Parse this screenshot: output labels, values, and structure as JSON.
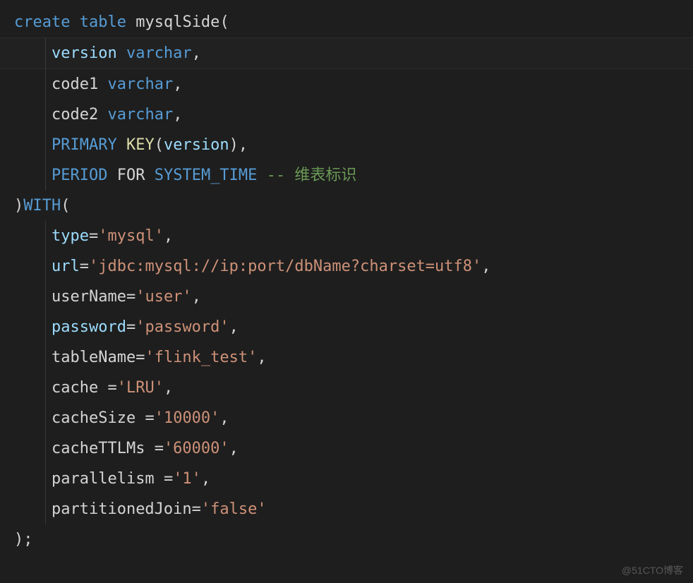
{
  "code": {
    "line1": {
      "kw1": "create",
      "kw2": "table",
      "name": "mysqlSide",
      "paren": "("
    },
    "line2": {
      "col": "version",
      "type": "varchar",
      "comma": ","
    },
    "line3": {
      "col": "code1",
      "type": "varchar",
      "comma": ","
    },
    "line4": {
      "col": "code2",
      "type": "varchar",
      "comma": ","
    },
    "line5": {
      "pk": "PRIMARY",
      "key": "KEY",
      "paren_open": "(",
      "col": "version",
      "paren_close": ")",
      "comma": ","
    },
    "line6": {
      "period": "PERIOD",
      "for": "FOR",
      "systime": "SYSTEM_TIME",
      "comment": "-- 维表标识"
    },
    "line7": {
      "close": ")",
      "with": "WITH",
      "open": "("
    },
    "line8": {
      "prop": "type",
      "eq": "=",
      "val": "'mysql'",
      "comma": ","
    },
    "line9": {
      "prop": "url",
      "eq": "=",
      "val": "'jdbc:mysql://ip:port/dbName?charset=utf8'",
      "comma": ","
    },
    "line10": {
      "prop": "userName",
      "eq": "=",
      "val": "'user'",
      "comma": ","
    },
    "line11": {
      "prop": "password",
      "eq": "=",
      "val": "'password'",
      "comma": ","
    },
    "line12": {
      "prop": "tableName",
      "eq": "=",
      "val": "'flink_test'",
      "comma": ","
    },
    "line13": {
      "prop": "cache",
      "sp": " ",
      "eq": "=",
      "val": "'LRU'",
      "comma": ","
    },
    "line14": {
      "prop": "cacheSize",
      "sp": " ",
      "eq": "=",
      "val": "'10000'",
      "comma": ","
    },
    "line15": {
      "prop": "cacheTTLMs",
      "sp": " ",
      "eq": "=",
      "val": "'60000'",
      "comma": ","
    },
    "line16": {
      "prop": "parallelism",
      "sp": " ",
      "eq": "=",
      "val": "'1'",
      "comma": ","
    },
    "line17": {
      "prop": "partitionedJoin",
      "eq": "=",
      "val": "'false'"
    },
    "line18": {
      "close": ")",
      "semi": ";"
    }
  },
  "watermark": "@51CTO博客"
}
